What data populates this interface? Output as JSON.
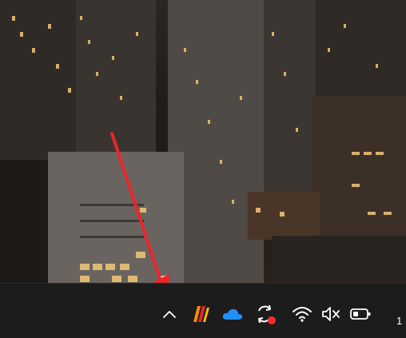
{
  "taskbar": {
    "tray": {
      "icons": [
        {
          "name": "chevron-up-icon",
          "role": "show hidden icons"
        },
        {
          "name": "app-stripes-icon",
          "role": "app tray icon"
        },
        {
          "name": "onedrive-cloud-icon",
          "role": "cloud storage"
        },
        {
          "name": "sync-icon",
          "role": "sync with red dot"
        },
        {
          "name": "wifi-icon",
          "role": "network"
        },
        {
          "name": "volume-muted-icon",
          "role": "volume"
        },
        {
          "name": "battery-icon",
          "role": "battery"
        }
      ]
    },
    "clock_text": "1"
  },
  "colors": {
    "taskbar": "#1c1c1c",
    "arrow": "#e8262b",
    "onedrive": "#1e90ff",
    "sync_dot": "#ff2a2a",
    "stripe_1": "#ff8a00",
    "stripe_2": "#e8262b",
    "stripe_3": "#f2c200"
  }
}
